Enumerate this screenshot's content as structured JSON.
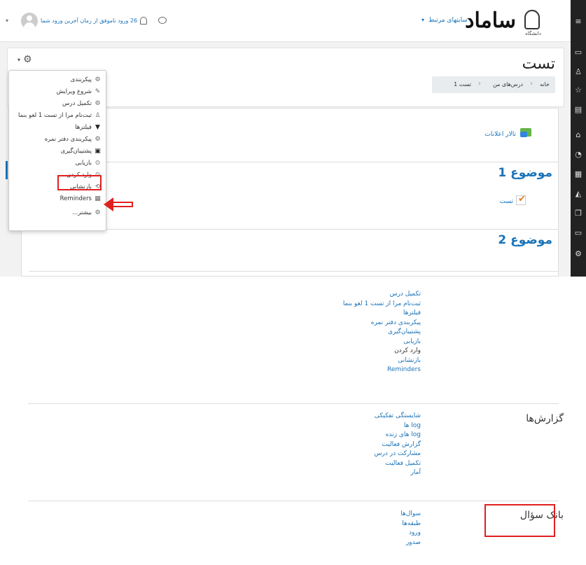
{
  "header": {
    "brand": "ساماد",
    "brand_sub": "دانشگاه",
    "related_sites": "سایتهای مرتبط",
    "login_note": "26 ورود ناموفق از زمان آخرین ورود شما"
  },
  "page": {
    "title": "تست",
    "breadcrumb": [
      "خانه",
      "درس‌های من",
      "تست 1"
    ]
  },
  "course": {
    "announcements": "تالار اعلانات",
    "topic1": "موضوع 1",
    "quiz": "تست",
    "topic2": "موضوع 2"
  },
  "action_menu": {
    "items": [
      {
        "label": "پیکربندی",
        "icon": "gear-icon"
      },
      {
        "label": "شروع ویرایش",
        "icon": "pencil-icon"
      },
      {
        "label": "تکمیل درس",
        "icon": "gear-icon"
      },
      {
        "label": "ثبت‌نام مرا از تست 1 لغو بنما",
        "icon": "user-icon"
      },
      {
        "label": "فیلترها",
        "icon": "filter-icon"
      },
      {
        "label": "پیکربندی دفتر نمره",
        "icon": "gear-icon"
      },
      {
        "label": "پشتیبان‌گیری",
        "icon": "backup-icon"
      },
      {
        "label": "بازیابی",
        "icon": "restore-icon"
      },
      {
        "label": "وارد کردن",
        "icon": "import-icon"
      },
      {
        "label": "بازنشانی",
        "icon": "reset-icon"
      },
      {
        "label": "Reminders",
        "icon": "calendar-icon"
      },
      {
        "label": "بیشتر...",
        "icon": "gear-icon"
      }
    ]
  },
  "more_page": {
    "course_links": [
      "تکمیل درس",
      "ثبت‌نام مرا از تست 1 لغو بنما",
      "فیلترها",
      "پیکربندی دفتر نمره",
      "پشتیبان‌گیری",
      "بازیابی",
      "وارد کردن",
      "بازنشانی",
      "Reminders"
    ],
    "reports_heading": "گزارش‌ها",
    "reports_links": [
      "شایستگی تفکیکی",
      "log ها",
      "log های زنده",
      "گزارش فعالیت",
      "مشارکت در درس",
      "تکمیل فعالیت",
      "آمار"
    ],
    "qbank_heading": "بانک سؤال",
    "qbank_links": [
      "سوال‌ها",
      "طبقه‌ها",
      "ورود",
      "صدور"
    ]
  },
  "colors": {
    "link": "#1a73b8",
    "highlight": "#e02020",
    "drawer": "#222222"
  }
}
